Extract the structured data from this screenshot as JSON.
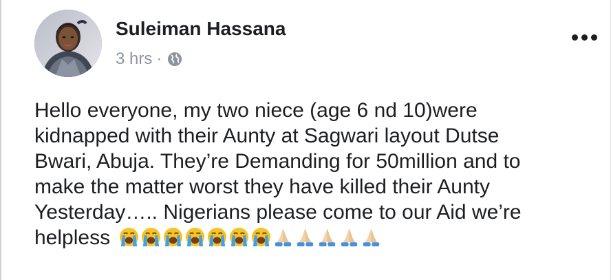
{
  "post": {
    "author": "Suleiman Hassana",
    "timestamp": "3 hrs",
    "separator": "·",
    "audience_icon": "globe-icon",
    "more_icon": "more-options-icon",
    "text_lines": [
      "Hello everyone, my two niece (age 6 nd 10)were",
      "kidnapped with their Aunty at Sagwari layout Dutse",
      "Bwari, Abuja. They’re Demanding for 50million and to",
      "make the matter worst they have killed their Aunty",
      "Yesterday….. Nigerians please come to our Aid we’re",
      "helpless"
    ],
    "emojis": [
      "loudly-crying-face",
      "loudly-crying-face",
      "loudly-crying-face",
      "loudly-crying-face",
      "loudly-crying-face",
      "loudly-crying-face",
      "loudly-crying-face",
      "folded-hands",
      "folded-hands",
      "folded-hands",
      "folded-hands",
      "folded-hands"
    ],
    "colors": {
      "text": "#1c1e21",
      "meta": "#8d949e",
      "emoji_face": "#f7c325",
      "emoji_tears": "#3fa2e8",
      "hands": "#f2d3a8",
      "sleeve": "#4a90d9"
    }
  }
}
